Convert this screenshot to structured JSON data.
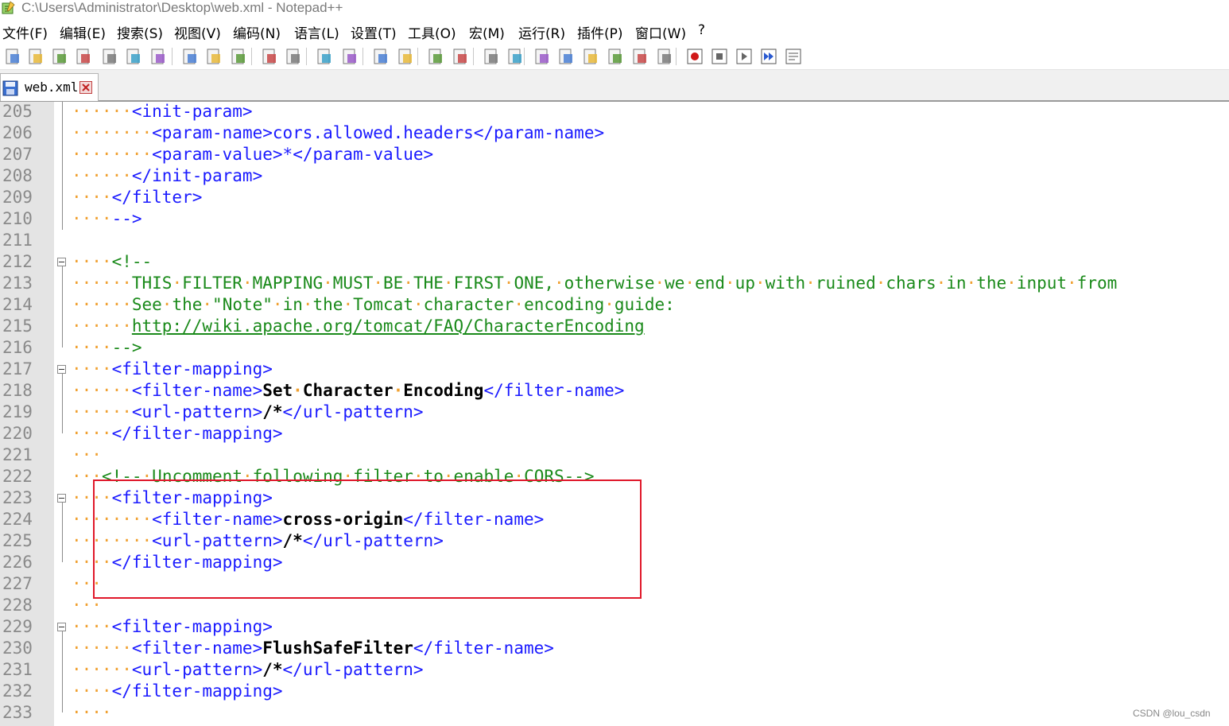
{
  "window": {
    "title": "C:\\Users\\Administrator\\Desktop\\web.xml - Notepad++"
  },
  "menu": [
    "文件(F)",
    "编辑(E)",
    "搜索(S)",
    "视图(V)",
    "编码(N)",
    "语言(L)",
    "设置(T)",
    "工具(O)",
    "宏(M)",
    "运行(R)",
    "插件(P)",
    "窗口(W)",
    "?"
  ],
  "toolbar_icons": [
    "new-file-icon",
    "open-file-icon",
    "save-icon",
    "save-all-icon",
    "close-icon",
    "close-all-icon",
    "print-icon",
    "cut-icon",
    "copy-icon",
    "paste-icon",
    "undo-icon",
    "redo-icon",
    "find-icon",
    "replace-icon",
    "zoom-in-icon",
    "zoom-out-icon",
    "sync-vertical-icon",
    "sync-horizontal-icon",
    "word-wrap-icon",
    "show-all-chars-icon",
    "indent-guide-icon",
    "udl-icon",
    "doc-map-icon",
    "function-list-icon",
    "folder-workspace-icon",
    "monitor-icon",
    "record-macro-icon",
    "stop-record-icon",
    "play-macro-icon",
    "run-macro-multiple-icon",
    "save-macro-icon"
  ],
  "tab": {
    "label": "web.xml"
  },
  "editor": {
    "lines": [
      {
        "n": "205",
        "ws": "······",
        "parts": [
          [
            "tag",
            "<init-param>"
          ]
        ]
      },
      {
        "n": "206",
        "ws": "········",
        "parts": [
          [
            "tag",
            "<param-name>"
          ],
          [
            "tag",
            "cors.allowed.headers"
          ],
          [
            "tag",
            "</param-name>"
          ]
        ]
      },
      {
        "n": "207",
        "ws": "········",
        "parts": [
          [
            "tag",
            "<param-value>"
          ],
          [
            "tag",
            "*"
          ],
          [
            "tag",
            "</param-value>"
          ]
        ]
      },
      {
        "n": "208",
        "ws": "······",
        "parts": [
          [
            "tag",
            "</init-param>"
          ]
        ]
      },
      {
        "n": "209",
        "ws": "····",
        "parts": [
          [
            "tag",
            "</filter>"
          ]
        ]
      },
      {
        "n": "210",
        "ws": "····",
        "parts": [
          [
            "tag",
            "-->"
          ]
        ]
      },
      {
        "n": "211",
        "ws": "",
        "parts": []
      },
      {
        "n": "212",
        "ws": "····",
        "parts": [
          [
            "cmt",
            "<!--"
          ]
        ]
      },
      {
        "n": "213",
        "ws": "······",
        "parts": [
          [
            "cmt",
            "THIS·FILTER·MAPPING·MUST·BE·THE·FIRST·ONE,·otherwise·we·end·up·with·ruined·chars·in·the·input·from"
          ]
        ]
      },
      {
        "n": "214",
        "ws": "······",
        "parts": [
          [
            "cmt",
            "See·the·\"Note\"·in·the·Tomcat·character·encoding·guide:"
          ]
        ]
      },
      {
        "n": "215",
        "ws": "······",
        "parts": [
          [
            "url",
            "http://wiki.apache.org/tomcat/FAQ/CharacterEncoding"
          ]
        ]
      },
      {
        "n": "216",
        "ws": "····",
        "parts": [
          [
            "cmt",
            "-->"
          ]
        ]
      },
      {
        "n": "217",
        "ws": "····",
        "parts": [
          [
            "tag",
            "<filter-mapping>"
          ]
        ]
      },
      {
        "n": "218",
        "ws": "······",
        "parts": [
          [
            "tag",
            "<filter-name>"
          ],
          [
            "txt",
            "Set·Character·Encoding"
          ],
          [
            "tag",
            "</filter-name>"
          ]
        ]
      },
      {
        "n": "219",
        "ws": "······",
        "parts": [
          [
            "tag",
            "<url-pattern>"
          ],
          [
            "txt",
            "/*"
          ],
          [
            "tag",
            "</url-pattern>"
          ]
        ]
      },
      {
        "n": "220",
        "ws": "····",
        "parts": [
          [
            "tag",
            "</filter-mapping>"
          ]
        ]
      },
      {
        "n": "221",
        "ws": "···",
        "parts": []
      },
      {
        "n": "222",
        "ws": "···",
        "parts": [
          [
            "cmt",
            "<!--·Uncomment·following·filter·to·enable·CORS-->"
          ]
        ]
      },
      {
        "n": "223",
        "ws": "····",
        "parts": [
          [
            "tag",
            "<filter-mapping>"
          ]
        ]
      },
      {
        "n": "224",
        "ws": "········",
        "parts": [
          [
            "tag",
            "<filter-name>"
          ],
          [
            "txt",
            "cross-origin"
          ],
          [
            "tag",
            "</filter-name>"
          ]
        ]
      },
      {
        "n": "225",
        "ws": "········",
        "parts": [
          [
            "tag",
            "<url-pattern>"
          ],
          [
            "txt",
            "/*"
          ],
          [
            "tag",
            "</url-pattern>"
          ]
        ]
      },
      {
        "n": "226",
        "ws": "····",
        "parts": [
          [
            "tag",
            "</filter-mapping>"
          ]
        ]
      },
      {
        "n": "227",
        "ws": "···",
        "parts": []
      },
      {
        "n": "228",
        "ws": "···",
        "parts": []
      },
      {
        "n": "229",
        "ws": "····",
        "parts": [
          [
            "tag",
            "<filter-mapping>"
          ]
        ]
      },
      {
        "n": "230",
        "ws": "······",
        "parts": [
          [
            "tag",
            "<filter-name>"
          ],
          [
            "txt",
            "FlushSafeFilter"
          ],
          [
            "tag",
            "</filter-name>"
          ]
        ]
      },
      {
        "n": "231",
        "ws": "······",
        "parts": [
          [
            "tag",
            "<url-pattern>"
          ],
          [
            "txt",
            "/*"
          ],
          [
            "tag",
            "</url-pattern>"
          ]
        ]
      },
      {
        "n": "232",
        "ws": "····",
        "parts": [
          [
            "tag",
            "</filter-mapping>"
          ]
        ]
      },
      {
        "n": "233",
        "ws": "····",
        "parts": []
      }
    ],
    "fold_markers": [
      "212",
      "217",
      "223",
      "229"
    ]
  },
  "watermark": "CSDN @lou_csdn",
  "colors": {
    "tag": "#1a1aff",
    "comment": "#1a8a1a",
    "whitespace": "#f0a030",
    "highlight_box": "#e0182a",
    "line_numbers_bg": "#e4e4e4"
  }
}
